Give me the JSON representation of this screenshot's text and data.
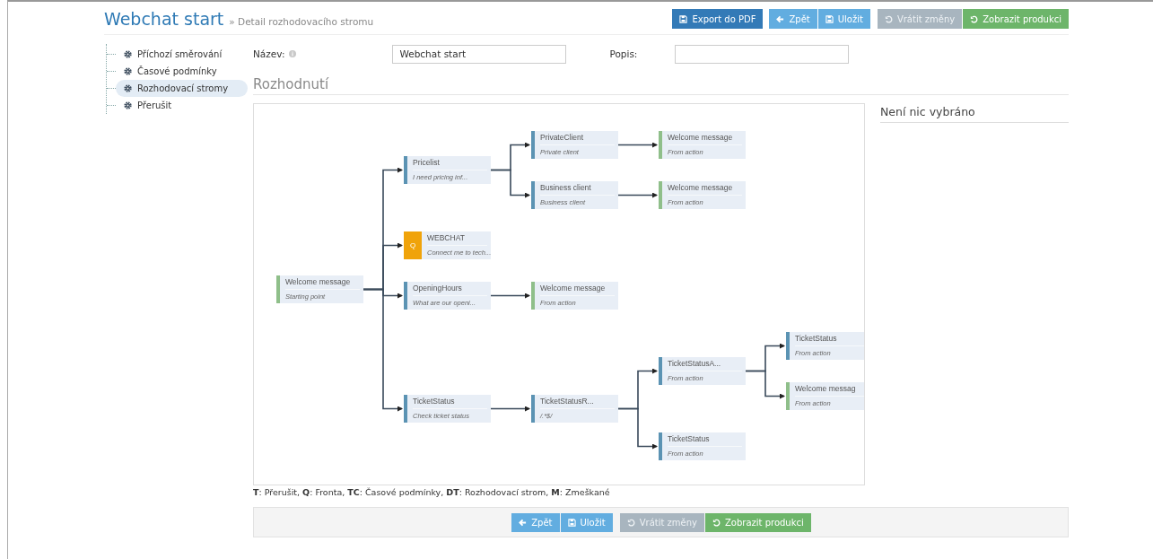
{
  "header": {
    "title": "Webchat start",
    "breadcrumb": "» Detail rozhodovacího stromu",
    "buttons": [
      {
        "label": "Export do PDF",
        "kind": "export"
      },
      {
        "label": "Zpět",
        "kind": "back"
      },
      {
        "label": "Uložit",
        "kind": "save"
      },
      {
        "label": "Vrátit změny",
        "kind": "revert"
      },
      {
        "label": "Zobrazit produkci",
        "kind": "production"
      }
    ]
  },
  "sidebar": {
    "items": [
      {
        "label": "Příchozí směrování",
        "selected": false
      },
      {
        "label": "Časové podmínky",
        "selected": false
      },
      {
        "label": "Rozhodovací stromy",
        "selected": true
      },
      {
        "label": "Přerušit",
        "selected": false
      }
    ]
  },
  "form": {
    "name_label": "Název:",
    "name_value": "Webchat start",
    "description_label": "Popis:"
  },
  "section_title": "Rozhodnutí",
  "detail_panel": {
    "title": "Není nic vybráno"
  },
  "tree": {
    "title": "Welcome message",
    "subtitle": "Starting point",
    "kind": "message",
    "children": [
      {
        "title": "Pricelist",
        "subtitle": "I need pricing inf...",
        "kind": "decision",
        "children": [
          {
            "title": "PrivateClient",
            "subtitle": "Private client",
            "kind": "decision",
            "children": [
              {
                "title": "Welcome message",
                "subtitle": "From action",
                "kind": "message"
              }
            ]
          },
          {
            "title": "Business client",
            "subtitle": "Business client",
            "kind": "decision",
            "children": [
              {
                "title": "Welcome message",
                "subtitle": "From action",
                "kind": "message"
              }
            ]
          }
        ]
      },
      {
        "title": "WEBCHAT",
        "subtitle": "Connect me to tech...",
        "kind": "queue",
        "badge": "Q"
      },
      {
        "title": "OpeningHours",
        "subtitle": "What are our openi...",
        "kind": "decision",
        "children": [
          {
            "title": "Welcome message",
            "subtitle": "From action",
            "kind": "message"
          }
        ]
      },
      {
        "title": "TicketStatus",
        "subtitle": "Check ticket status",
        "kind": "decision",
        "children": [
          {
            "title": "TicketStatusR...",
            "subtitle": "/.*$/",
            "kind": "decision",
            "children": [
              {
                "title": "TicketStatusA...",
                "subtitle": "From action",
                "kind": "decision",
                "children": [
                  {
                    "title": "TicketStatus",
                    "subtitle": "From action",
                    "kind": "decision"
                  },
                  {
                    "title": "Welcome messag",
                    "subtitle": "From action",
                    "kind": "message"
                  }
                ]
              },
              {
                "title": "TicketStatus",
                "subtitle": "From action",
                "kind": "decision"
              }
            ]
          }
        ]
      }
    ]
  },
  "legend": "**T**: Přerušit,  **Q**: Fronta,  **TC**: Časové podmínky,  **DT**: Rozhodovací strom,  **M**: Zmeškané",
  "footer_buttons": [
    {
      "label": "Zpět",
      "kind": "back"
    },
    {
      "label": "Uložit",
      "kind": "save"
    },
    {
      "label": "Vrátit změny",
      "kind": "revert"
    },
    {
      "label": "Zobrazit produkci",
      "kind": "production"
    }
  ]
}
